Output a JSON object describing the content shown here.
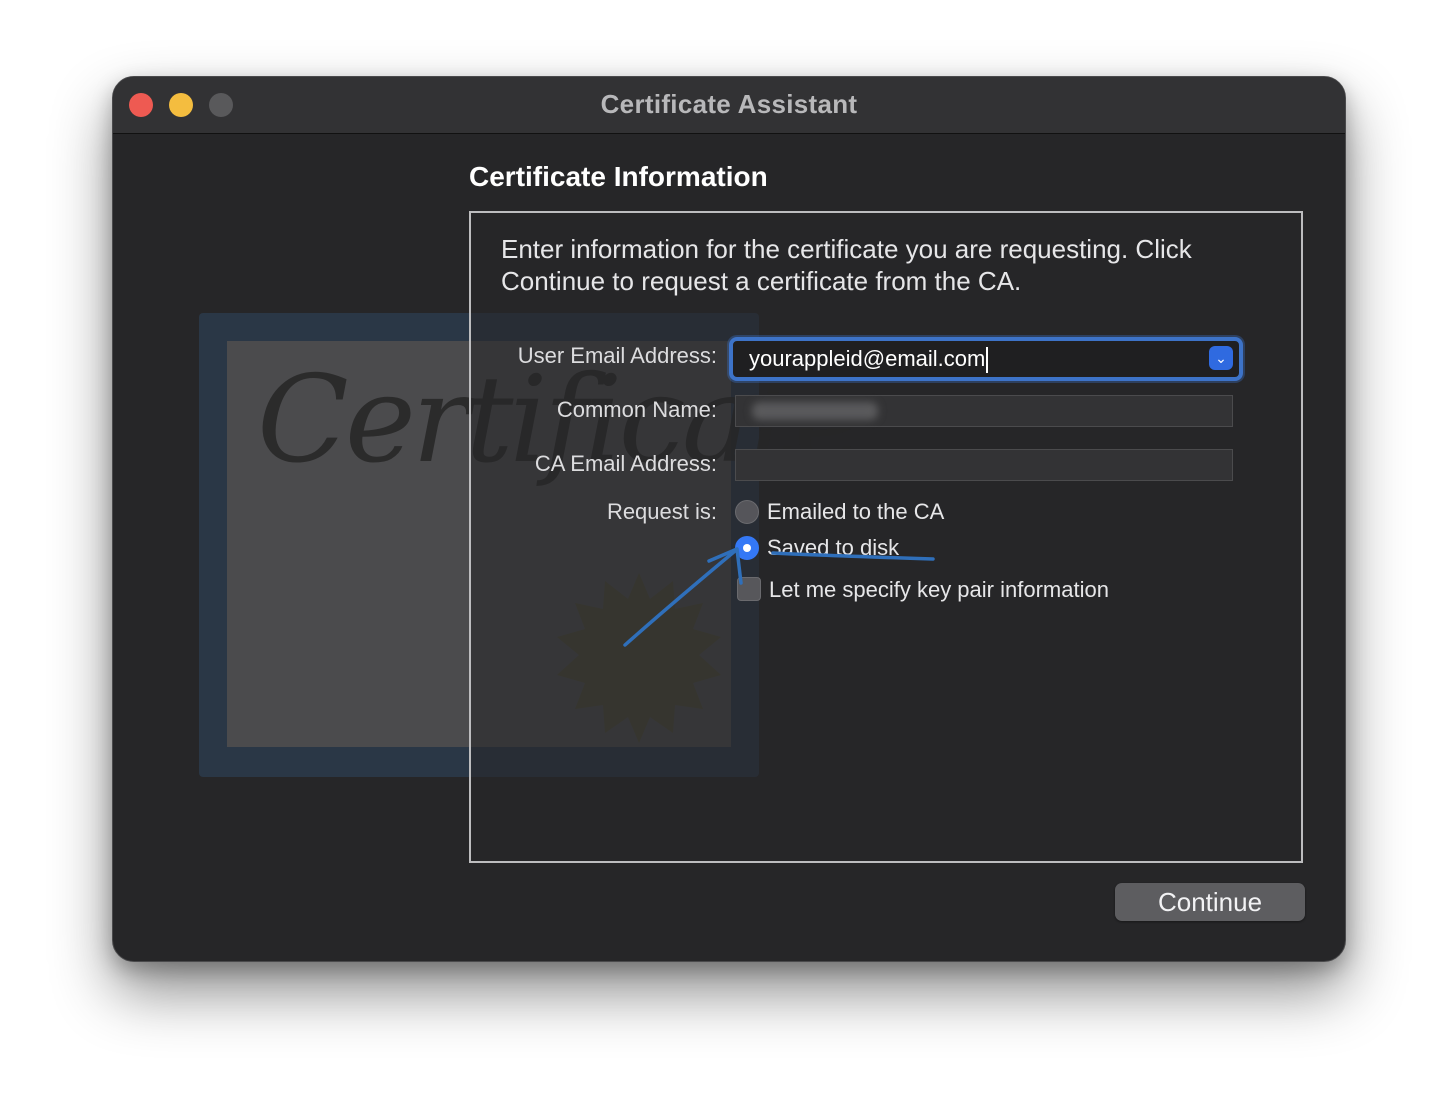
{
  "window": {
    "title": "Certificate Assistant"
  },
  "section": {
    "title": "Certificate Information",
    "intro": "Enter information for the certificate you are requesting. Click Continue to request a certificate from the CA."
  },
  "form": {
    "user_email_label": "User Email Address:",
    "user_email_value": "yourappleid@email.com",
    "common_name_label": "Common Name:",
    "ca_email_label": "CA Email Address:",
    "request_is_label": "Request is:",
    "options": [
      {
        "label": "Emailed to the CA",
        "selected": false
      },
      {
        "label": "Saved to disk",
        "selected": true
      }
    ],
    "key_pair_label": "Let me specify key pair information",
    "key_pair_checked": false
  },
  "watermark": {
    "text": "Certificate"
  },
  "buttons": {
    "continue": "Continue"
  },
  "colors": {
    "window_bg": "#262628",
    "accent": "#3478f6",
    "annotation": "#2f6fba"
  },
  "icons": {
    "combo": "chevron-down-icon"
  }
}
